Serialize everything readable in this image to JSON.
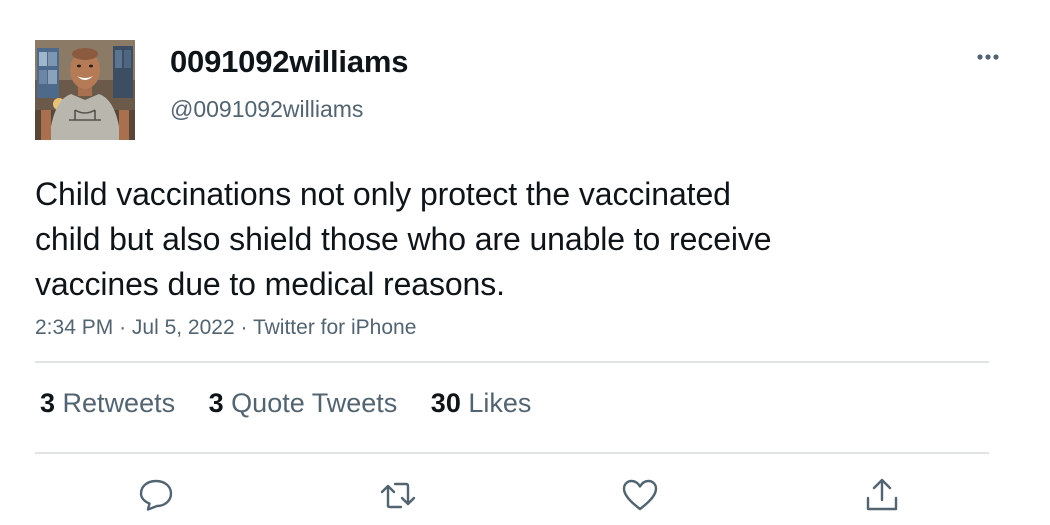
{
  "author": {
    "display_name": "0091092williams",
    "handle": "@0091092williams"
  },
  "tweet": {
    "text": "Child vaccinations not only protect the vaccinated\nchild but also shield those who are unable to receive\nvaccines due to medical reasons.",
    "time": "2:34 PM",
    "separator": "·",
    "date": "Jul 5, 2022",
    "source": "Twitter for iPhone"
  },
  "stats": {
    "retweets": {
      "count": "3",
      "label": "Retweets"
    },
    "quote_tweets": {
      "count": "3",
      "label": "Quote Tweets"
    },
    "likes": {
      "count": "30",
      "label": "Likes"
    }
  },
  "actions": {
    "reply_icon": "reply-icon",
    "retweet_icon": "retweet-icon",
    "like_icon": "heart-icon",
    "share_icon": "share-icon",
    "more_icon": "more-options-icon"
  },
  "colors": {
    "text_primary": "#0f1419",
    "text_secondary": "#536471",
    "divider": "#e1e4e7",
    "icon": "#536471"
  }
}
